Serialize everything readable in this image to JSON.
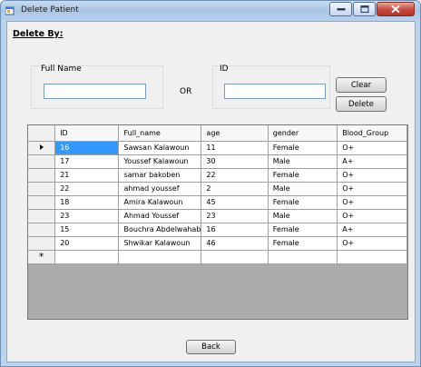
{
  "window": {
    "title": "Delete Patient"
  },
  "heading": "Delete By:",
  "fullname_group": {
    "label": "Full Name",
    "value": ""
  },
  "or_label": "OR",
  "id_group": {
    "label": "ID",
    "value": ""
  },
  "buttons": {
    "clear": "Clear",
    "delete": "Delete",
    "back": "Back"
  },
  "table": {
    "columns": [
      "ID",
      "Full_name",
      "age",
      "gender",
      "Blood_Group"
    ],
    "rows": [
      [
        "16",
        "Sawsan Kalawoun",
        "11",
        "Female",
        "O+"
      ],
      [
        "17",
        "Youssef Kalawoun",
        "30",
        "Male",
        "A+"
      ],
      [
        "21",
        "samar bakoben",
        "22",
        "Female",
        "O+"
      ],
      [
        "22",
        "ahmad youssef",
        "2",
        "Male",
        "O+"
      ],
      [
        "18",
        "Amira Kalawoun",
        "45",
        "Female",
        "O+"
      ],
      [
        "23",
        "Ahmad Youssef",
        "23",
        "Male",
        "O+"
      ],
      [
        "15",
        "Bouchra Abdelwahab",
        "16",
        "Female",
        "A+"
      ],
      [
        "20",
        "Shwikar Kalawoun",
        "46",
        "Female",
        "O+"
      ]
    ],
    "new_row_marker": "*"
  },
  "colors": {
    "selection": "#3399ff",
    "grid_background": "#ababab",
    "title_bar": "#bcd3ee"
  },
  "icons": {
    "app": "window-app-icon",
    "minimize": "minimize-icon",
    "maximize": "maximize-icon",
    "close": "close-icon",
    "current_row": "row-pointer-icon"
  }
}
